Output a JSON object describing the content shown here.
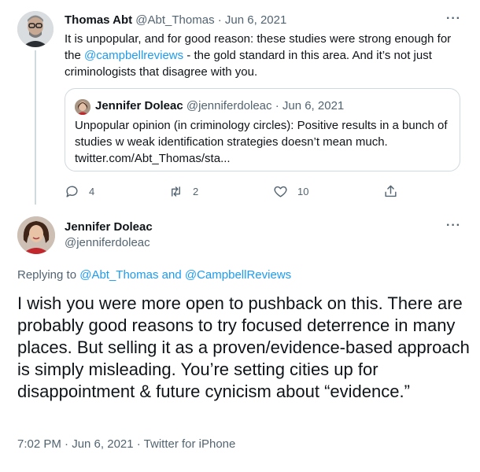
{
  "parent": {
    "name": "Thomas Abt",
    "handle": "@Abt_Thomas",
    "date": "· Jun 6, 2021",
    "text_1": "It is unpopular, and for good reason: these studies were strong enough for the ",
    "mention": "@campbellreviews",
    "text_2": " - the gold standard in this area. And it’s not just criminologists that disagree with you.",
    "more": "···"
  },
  "quote": {
    "name": "Jennifer Doleac",
    "handle": "@jenniferdoleac",
    "date": "· Jun 6, 2021",
    "text": "Unpopular opinion (in criminology circles): Positive results in a bunch of studies w weak identification strategies doesn’t mean much. twitter.com/Abt_Thomas/sta..."
  },
  "actions": {
    "replies": "4",
    "retweets": "2",
    "likes": "10"
  },
  "main": {
    "name": "Jennifer Doleac",
    "handle": "@jenniferdoleac",
    "more": "···",
    "replying_prefix": "Replying to ",
    "reply_user_1": "@Abt_Thomas",
    "reply_and": " and ",
    "reply_user_2": "@CampbellReviews",
    "text": "I wish you were more open to pushback on this. There are probably good reasons to try focused deterrence in many places. But selling it as a proven/evidence-based approach is simply misleading. You’re setting cities up for disappointment & future cynicism about “evidence.”",
    "meta": "7:02 PM · Jun 6, 2021 · Twitter for iPhone"
  },
  "colors": {
    "link": "#1d9bf0",
    "muted": "#536471",
    "border": "#cfd9de"
  }
}
